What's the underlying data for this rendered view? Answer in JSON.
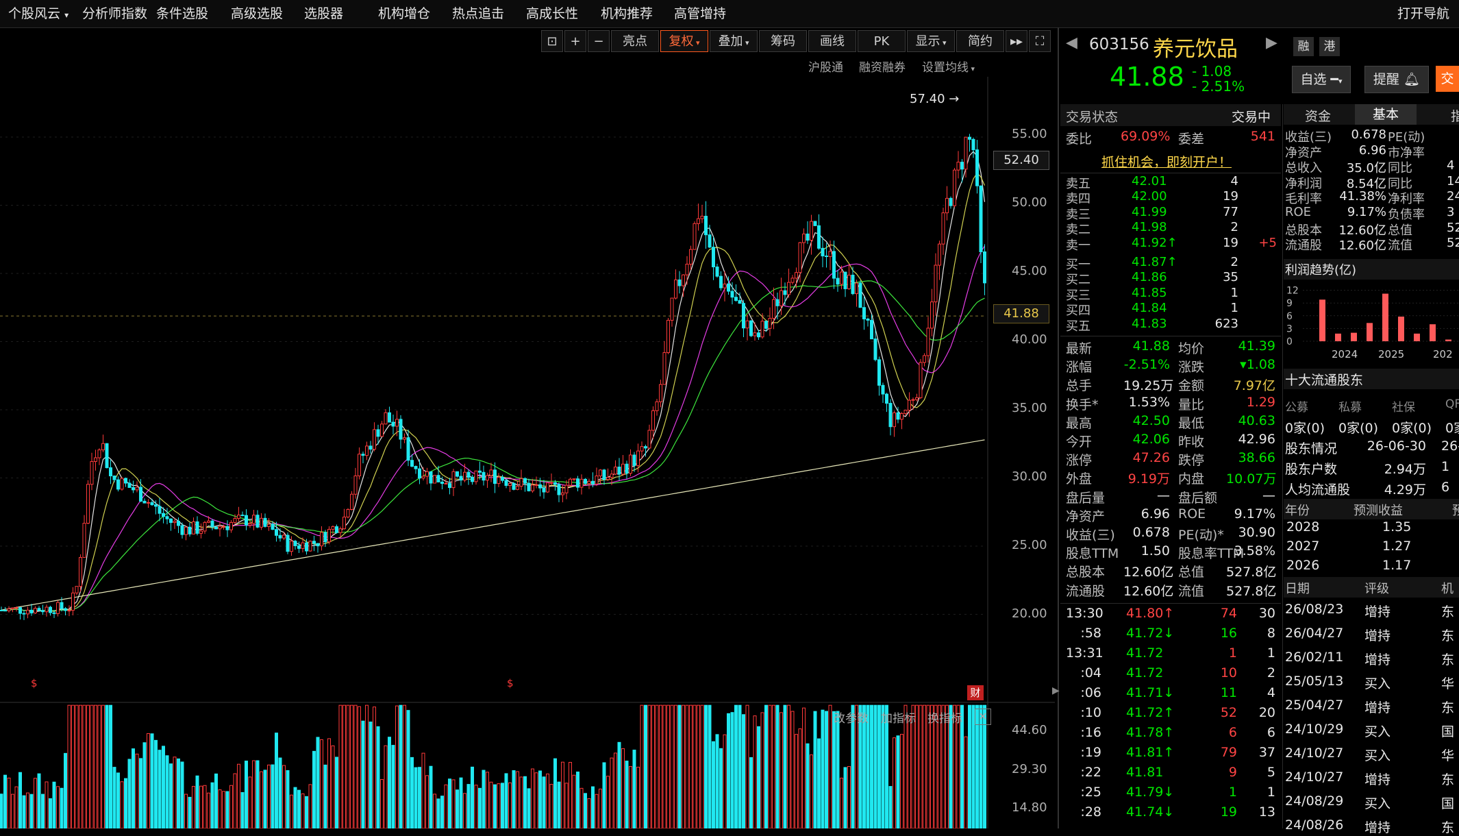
{
  "menu": {
    "items": [
      "个股风云",
      "分析师指数",
      "条件选股",
      "高级选股",
      "选股器",
      "机构增仓",
      "热点追击",
      "高成长性",
      "机构推荐",
      "高管增持"
    ],
    "right": "打开导航"
  },
  "toolbar": {
    "buttons": [
      "亮点",
      "复权",
      "叠加",
      "筹码",
      "画线",
      "PK",
      "显示",
      "简约"
    ],
    "sub": [
      "沪股通",
      "融资融券",
      "设置均线"
    ],
    "bottom": [
      "改参数",
      "加指标",
      "换指标"
    ]
  },
  "chart_data": {
    "type": "candlestick",
    "y_axis_labels": [
      "55.00",
      "50.00",
      "45.00",
      "40.00",
      "35.00",
      "30.00",
      "25.00",
      "20.00"
    ],
    "ylim": [
      18.0,
      58.0
    ],
    "current_price_label": "41.88",
    "crosshair_label": "52.40",
    "high_marker": "57.40",
    "volume_axis_labels": [
      "44.60",
      "29.30",
      "14.80"
    ],
    "ma_series_colors": [
      "#ffffff",
      "#e8e85a",
      "#ff44ff",
      "#44ff44",
      "#ffffcc"
    ],
    "rise_color": "#ff3a3a",
    "fall_color": "#20e8f0"
  },
  "stock": {
    "code": "603156",
    "name": "养元饮品",
    "price": "41.88",
    "change": "- 1.08",
    "change_pct": "- 2.51%",
    "badges": [
      "融",
      "港"
    ],
    "buttons": {
      "watch": "自选",
      "alert": "提醒",
      "trade": "交"
    }
  },
  "status": {
    "label": "交易状态",
    "value": "交易中"
  },
  "ratio": {
    "wb_label": "委比",
    "wb": "69.09%",
    "wc_label": "委差",
    "wc": "541"
  },
  "promo": "抓住机会，即刻开户！",
  "asks": [
    {
      "label": "卖五",
      "price": "42.01",
      "vol": "4",
      "extra": ""
    },
    {
      "label": "卖四",
      "price": "42.00",
      "vol": "19",
      "extra": ""
    },
    {
      "label": "卖三",
      "price": "41.99",
      "vol": "77",
      "extra": ""
    },
    {
      "label": "卖二",
      "price": "41.98",
      "vol": "2",
      "extra": ""
    },
    {
      "label": "卖一",
      "price": "41.92↑",
      "vol": "19",
      "extra": "+5"
    }
  ],
  "bids": [
    {
      "label": "买一",
      "price": "41.87↑",
      "vol": "2"
    },
    {
      "label": "买二",
      "price": "41.86",
      "vol": "35"
    },
    {
      "label": "买三",
      "price": "41.85",
      "vol": "1"
    },
    {
      "label": "买四",
      "price": "41.84",
      "vol": "1"
    },
    {
      "label": "买五",
      "price": "41.83",
      "vol": "623"
    }
  ],
  "quote": [
    [
      [
        "最新",
        "41.88",
        "grn"
      ],
      [
        "均价",
        "41.39",
        "grn"
      ]
    ],
    [
      [
        "涨幅",
        "-2.51%",
        "grn"
      ],
      [
        "涨跌",
        "▾1.08",
        "grn"
      ]
    ],
    [
      [
        "总手",
        "19.25万",
        "wht"
      ],
      [
        "金额",
        "7.97亿",
        "yel"
      ]
    ],
    [
      [
        "换手*",
        "1.53%",
        "wht"
      ],
      [
        "量比",
        "1.29",
        "red"
      ]
    ],
    [
      [
        "最高",
        "42.50",
        "grn"
      ],
      [
        "最低",
        "40.63",
        "grn"
      ]
    ],
    [
      [
        "今开",
        "42.06",
        "grn"
      ],
      [
        "昨收",
        "42.96",
        "wht"
      ]
    ],
    [
      [
        "涨停",
        "47.26",
        "red"
      ],
      [
        "跌停",
        "38.66",
        "grn"
      ]
    ],
    [
      [
        "外盘",
        "9.19万",
        "red"
      ],
      [
        "内盘",
        "10.07万",
        "grn"
      ]
    ],
    [
      [
        "盘后量",
        "—",
        "wht"
      ],
      [
        "盘后额",
        "—",
        "wht"
      ]
    ],
    [
      [
        "净资产",
        "6.96",
        "wht"
      ],
      [
        "ROE",
        "9.17%",
        "wht"
      ]
    ],
    [
      [
        "收益(三)",
        "0.678",
        "wht"
      ],
      [
        "PE(动)*",
        "30.90",
        "wht"
      ]
    ],
    [
      [
        "股息TTM",
        "1.50",
        "wht"
      ],
      [
        "股息率TTM",
        "3.58%",
        "wht"
      ]
    ],
    [
      [
        "总股本",
        "12.60亿",
        "wht"
      ],
      [
        "总值",
        "527.8亿",
        "wht"
      ]
    ],
    [
      [
        "流通股",
        "12.60亿",
        "wht"
      ],
      [
        "流值",
        "527.8亿",
        "wht"
      ]
    ]
  ],
  "ticks": [
    {
      "time": "13:30",
      "price": "41.80↑",
      "vol": "74",
      "n": "30",
      "pc": "red",
      "vc": "red"
    },
    {
      "time": ":58",
      "price": "41.72↓",
      "vol": "16",
      "n": "8",
      "pc": "grn",
      "vc": "grn"
    },
    {
      "time": "13:31",
      "price": "41.72",
      "vol": "1",
      "n": "1",
      "pc": "grn",
      "vc": "red"
    },
    {
      "time": ":04",
      "price": "41.72",
      "vol": "10",
      "n": "2",
      "pc": "grn",
      "vc": "red"
    },
    {
      "time": ":06",
      "price": "41.71↓",
      "vol": "11",
      "n": "4",
      "pc": "grn",
      "vc": "grn"
    },
    {
      "time": ":10",
      "price": "41.72↑",
      "vol": "52",
      "n": "20",
      "pc": "grn",
      "vc": "red"
    },
    {
      "time": ":16",
      "price": "41.78↑",
      "vol": "6",
      "n": "6",
      "pc": "grn",
      "vc": "red"
    },
    {
      "time": ":19",
      "price": "41.81↑",
      "vol": "79",
      "n": "37",
      "pc": "grn",
      "vc": "red"
    },
    {
      "time": ":22",
      "price": "41.81",
      "vol": "9",
      "n": "5",
      "pc": "grn",
      "vc": "red"
    },
    {
      "time": ":25",
      "price": "41.79↓",
      "vol": "1",
      "n": "1",
      "pc": "grn",
      "vc": "grn"
    },
    {
      "time": ":28",
      "price": "41.74↓",
      "vol": "19",
      "n": "13",
      "pc": "grn",
      "vc": "grn"
    }
  ],
  "tabs": [
    "资金",
    "基本",
    "指"
  ],
  "fundamentals": [
    [
      "收益(三)",
      "0.678",
      "PE(动)",
      ""
    ],
    [
      "净资产",
      "6.96",
      "市净率",
      ""
    ],
    [
      "总收入",
      "35.0亿",
      "同比",
      "4"
    ],
    [
      "净利润",
      "8.54亿",
      "同比",
      "14"
    ],
    [
      "毛利率",
      "41.38%",
      "净利率",
      "24"
    ],
    [
      "ROE",
      "9.17%",
      "负债率",
      "3"
    ],
    [
      "总股本",
      "12.60亿",
      "总值",
      "52"
    ],
    [
      "流通股",
      "12.60亿",
      "流值",
      "52"
    ]
  ],
  "profit_trend": {
    "title": "利润趋势(亿)",
    "y_labels": [
      "12",
      "9",
      "6",
      "3",
      "0"
    ],
    "x_labels": [
      "2024",
      "2025",
      "202"
    ],
    "bars": [
      9.8,
      1.8,
      2.0,
      4.3,
      11.2,
      5.8,
      1.8,
      4.0,
      0.4,
      9.8
    ]
  },
  "holders": {
    "title": "十大流通股东",
    "cats": [
      "公募",
      "私募",
      "社保",
      "QF"
    ],
    "counts": [
      "0家(0)",
      "0家(0)",
      "0家(0)",
      "0家"
    ],
    "rows": [
      [
        "股东情况",
        "26-06-30",
        "26-"
      ],
      [
        "股东户数",
        "2.94万",
        "1"
      ],
      [
        "人均流通股",
        "4.29万",
        "6"
      ]
    ]
  },
  "forecast": {
    "headers": [
      "年份",
      "预测收益",
      "预"
    ],
    "rows": [
      [
        "2028",
        "1.35"
      ],
      [
        "2027",
        "1.27"
      ],
      [
        "2026",
        "1.17"
      ]
    ]
  },
  "ratings": {
    "headers": [
      "日期",
      "评级",
      "机"
    ],
    "rows": [
      [
        "26/08/23",
        "增持",
        "东"
      ],
      [
        "26/04/27",
        "增持",
        "东"
      ],
      [
        "26/02/11",
        "增持",
        "东"
      ],
      [
        "25/05/13",
        "买入",
        "华"
      ],
      [
        "25/04/27",
        "增持",
        "东"
      ],
      [
        "24/10/29",
        "买入",
        "国"
      ],
      [
        "24/10/27",
        "买入",
        "华"
      ],
      [
        "24/10/27",
        "增持",
        "东"
      ],
      [
        "24/08/29",
        "买入",
        "国"
      ],
      [
        "24/08/26",
        "增持",
        "东"
      ]
    ]
  }
}
